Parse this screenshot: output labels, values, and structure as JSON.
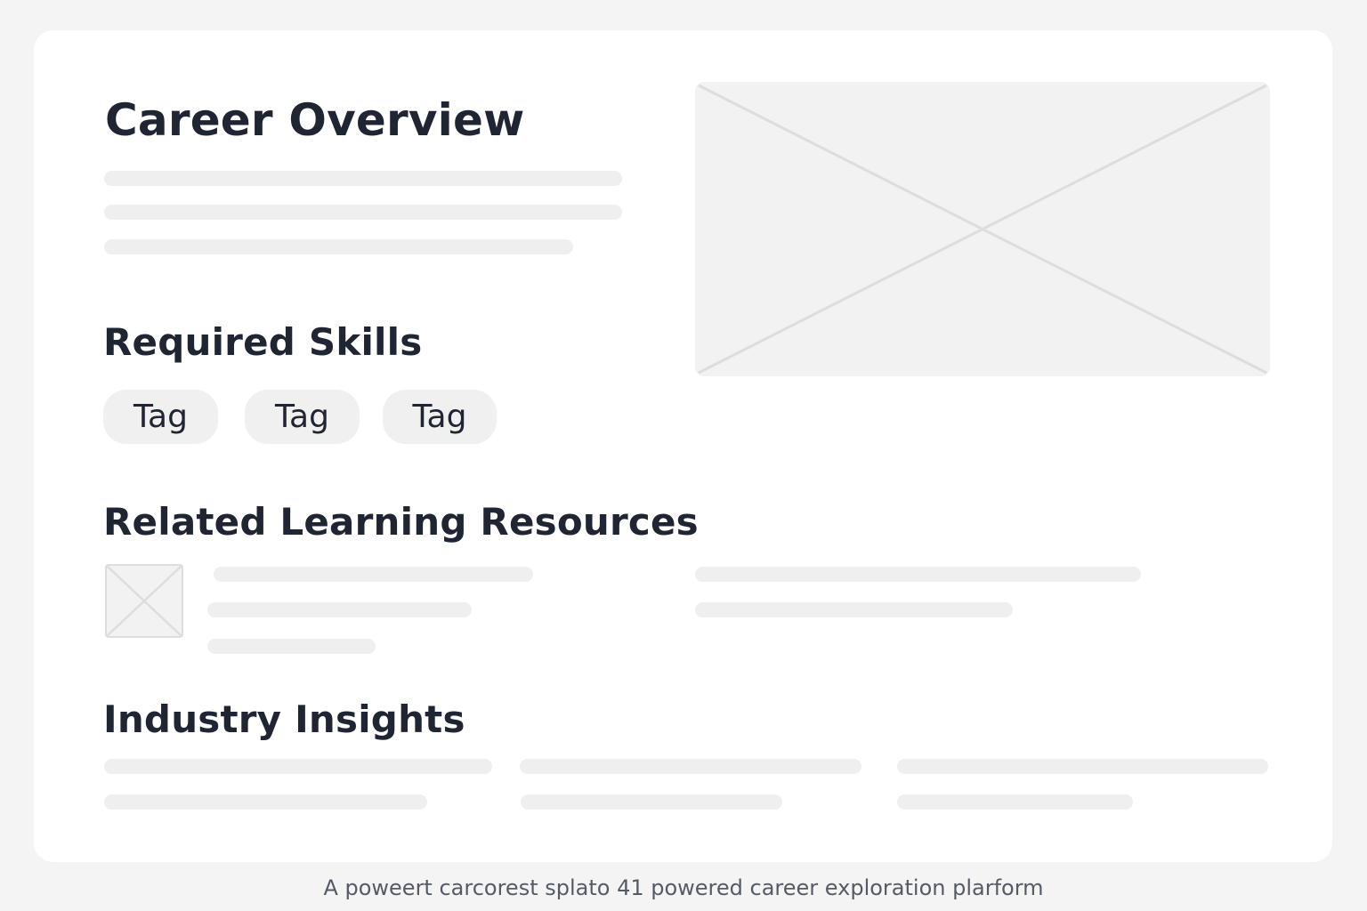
{
  "overview": {
    "title": "Career Overview"
  },
  "skills": {
    "title": "Required Skills",
    "tags": [
      "Tag",
      "Tag",
      "Tag"
    ]
  },
  "resources": {
    "title": "Related Learning Resources"
  },
  "insights": {
    "title": "Industry Insights"
  },
  "footer": {
    "caption": "A poweert carcorest splato 41 powered career exploration plarform"
  },
  "colors": {
    "heading": "#1f2533",
    "placeholder": "#efefef",
    "card": "#ffffff",
    "background": "#f4f4f4"
  }
}
